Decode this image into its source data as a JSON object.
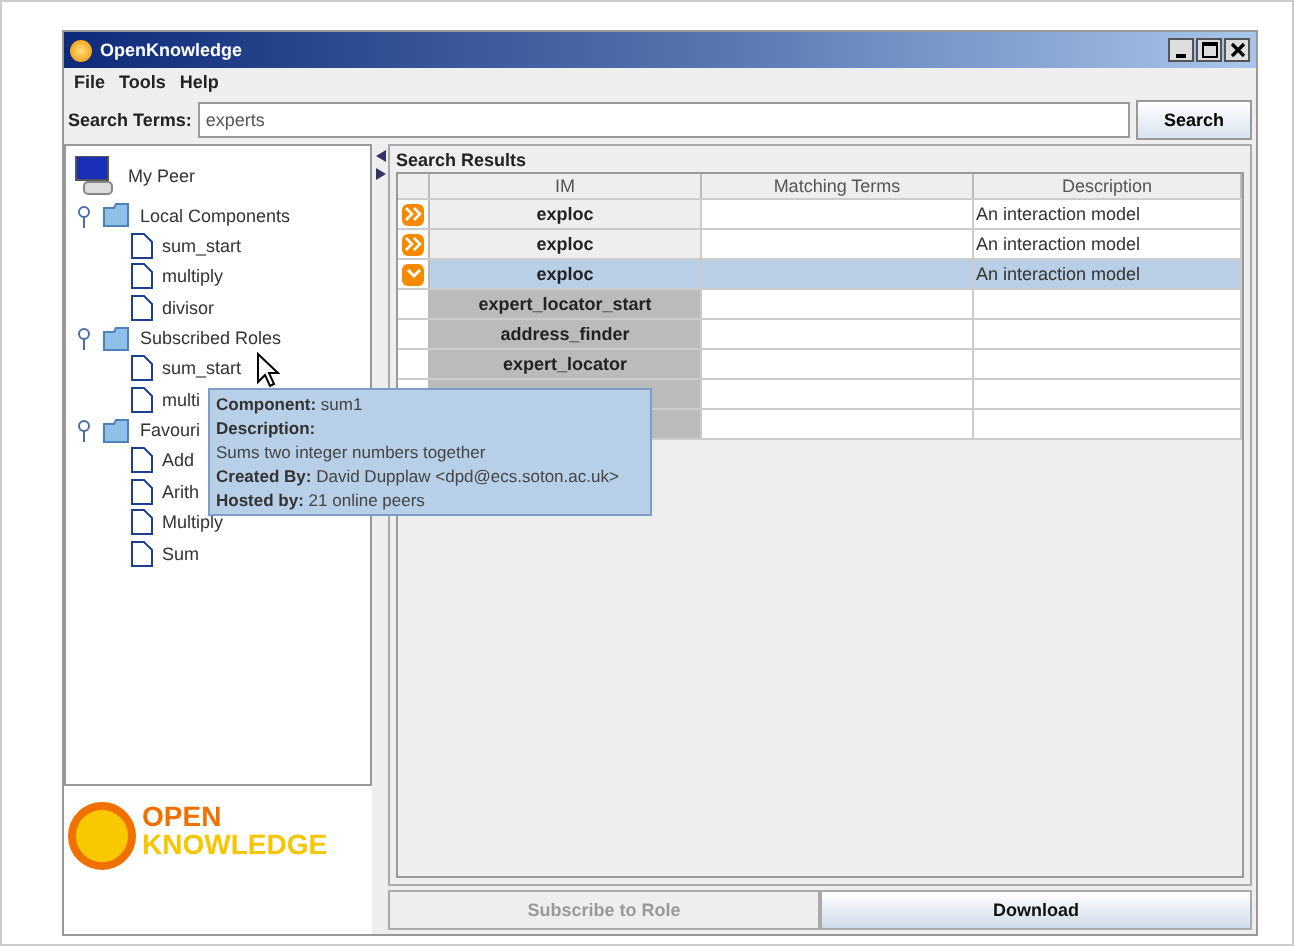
{
  "window": {
    "title": "OpenKnowledge"
  },
  "menu": [
    "File",
    "Tools",
    "Help"
  ],
  "search": {
    "label": "Search Terms:",
    "value": "experts",
    "button": "Search"
  },
  "tree": {
    "root": "My Peer",
    "groups": [
      {
        "label": "Local Components",
        "expanded": true,
        "children": [
          {
            "label": "sum_start"
          },
          {
            "label": "multiply"
          },
          {
            "label": "divisor"
          }
        ]
      },
      {
        "label": "Subscribed Roles",
        "expanded": true,
        "children": [
          {
            "label": "sum_start"
          },
          {
            "label": "multi"
          }
        ]
      },
      {
        "label": "Favouri",
        "expanded": true,
        "children": [
          {
            "label": "Add"
          },
          {
            "label": "Arith"
          },
          {
            "label": "Multiply"
          },
          {
            "label": "Sum"
          }
        ]
      }
    ]
  },
  "logo": {
    "line1": "OPEN",
    "line2": "KNOWLEDGE"
  },
  "results": {
    "title": "Search Results",
    "columns": [
      "IM",
      "Matching Terms",
      "Description"
    ],
    "rows": [
      {
        "kind": "model",
        "expanded": false,
        "selected": false,
        "im": "exploc",
        "description": "An interaction model"
      },
      {
        "kind": "model",
        "expanded": false,
        "selected": false,
        "im": "exploc",
        "description": "An interaction model"
      },
      {
        "kind": "model",
        "expanded": true,
        "selected": true,
        "im": "exploc",
        "description": "An interaction model"
      },
      {
        "kind": "role",
        "selected": false,
        "im": "expert_locator_start"
      },
      {
        "kind": "role",
        "selected": false,
        "im": "address_finder"
      },
      {
        "kind": "role",
        "selected": false,
        "im": "expert_locator"
      },
      {
        "kind": "role",
        "selected": false
      },
      {
        "kind": "role",
        "selected": false
      }
    ]
  },
  "tooltip": {
    "lines": [
      {
        "label": "Component:",
        "value": "sum1"
      },
      {
        "label": "Description:"
      },
      {
        "value": "Sums two integer numbers together"
      },
      {
        "label": "Created By:",
        "value": "David Dupplaw <dpd@ecs.soton.ac.uk>"
      },
      {
        "label": "Hosted by:",
        "value": "21 online peers"
      }
    ]
  },
  "buttons": [
    {
      "label": "Subscribe to Role",
      "disabled": true
    },
    {
      "label": "Download",
      "disabled": false
    }
  ]
}
